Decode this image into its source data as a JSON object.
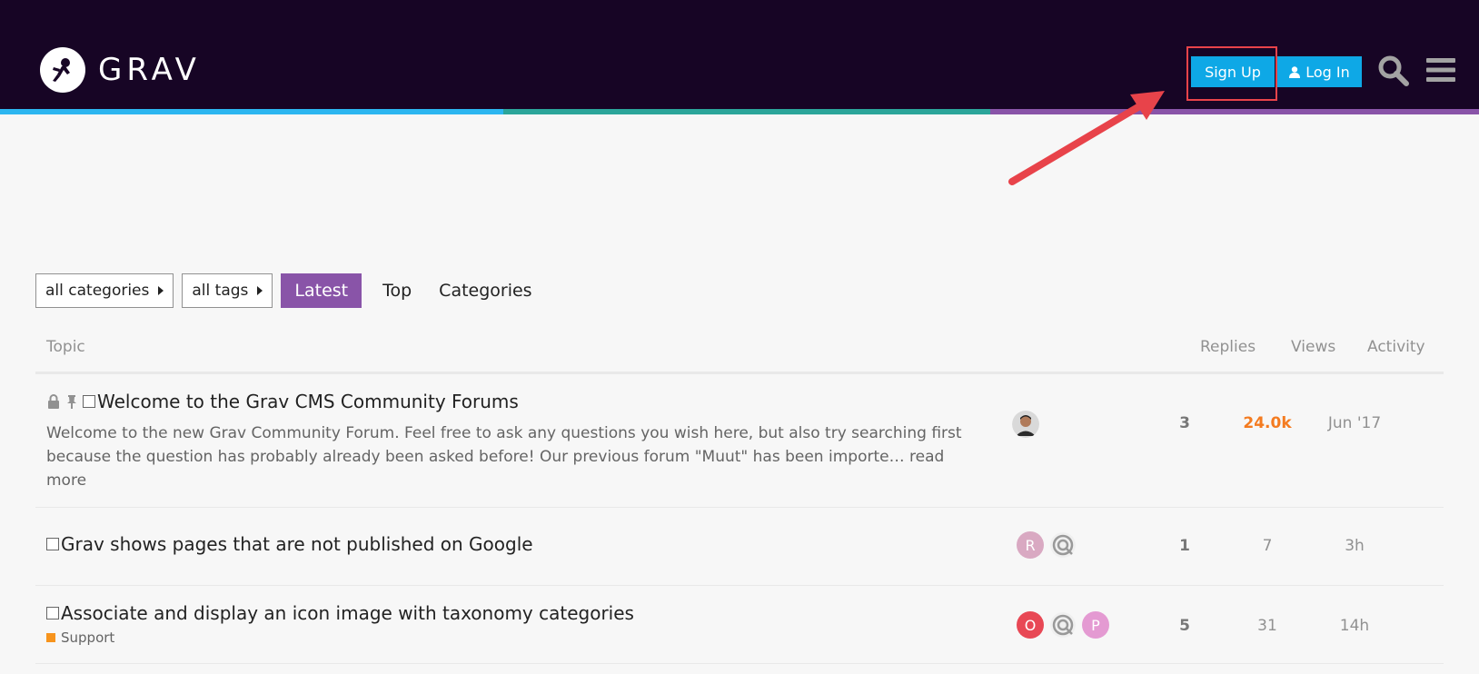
{
  "header": {
    "logo_text": "GRAV",
    "signup_label": "Sign Up",
    "login_label": "Log In",
    "stripe_colors": [
      "#2cb6f0",
      "#2ba59a",
      "#8954a8"
    ],
    "background": "#170525",
    "icons": [
      "astronaut-logo-icon",
      "user-icon",
      "search-icon",
      "hamburger-menu-icon"
    ]
  },
  "nav": {
    "categories_dropdown": "all categories",
    "tags_dropdown": "all tags",
    "tabs": [
      {
        "label": "Latest",
        "active": true
      },
      {
        "label": "Top",
        "active": false
      },
      {
        "label": "Categories",
        "active": false
      }
    ],
    "accent": "#8954a8"
  },
  "table": {
    "columns": {
      "topic": "Topic",
      "replies": "Replies",
      "views": "Views",
      "activity": "Activity"
    },
    "rows": [
      {
        "title": "Welcome to the Grav CMS Community Forums",
        "status_icons": [
          "lock-icon",
          "pin-icon"
        ],
        "excerpt": "Welcome to the new Grav Community Forum. Feel free to ask any questions you wish here, but also try searching first because the question has probably already been asked before! Our previous forum \"Muut\" has been importe…",
        "read_more": "read more",
        "posters": [
          "photo"
        ],
        "replies": "3",
        "views": "24.0k",
        "activity": "Jun '17"
      },
      {
        "title": "Grav shows pages that are not published on Google",
        "posters": [
          "R",
          "logo"
        ],
        "replies": "1",
        "views": "7",
        "activity": "3h"
      },
      {
        "title": "Associate and display an icon image with taxonomy categories",
        "category": "Support",
        "category_color": "#f7941d",
        "posters": [
          "O",
          "logo",
          "P"
        ],
        "replies": "5",
        "views": "31",
        "activity": "14h"
      }
    ]
  },
  "annotation": {
    "highlight_color": "#e8434a"
  }
}
